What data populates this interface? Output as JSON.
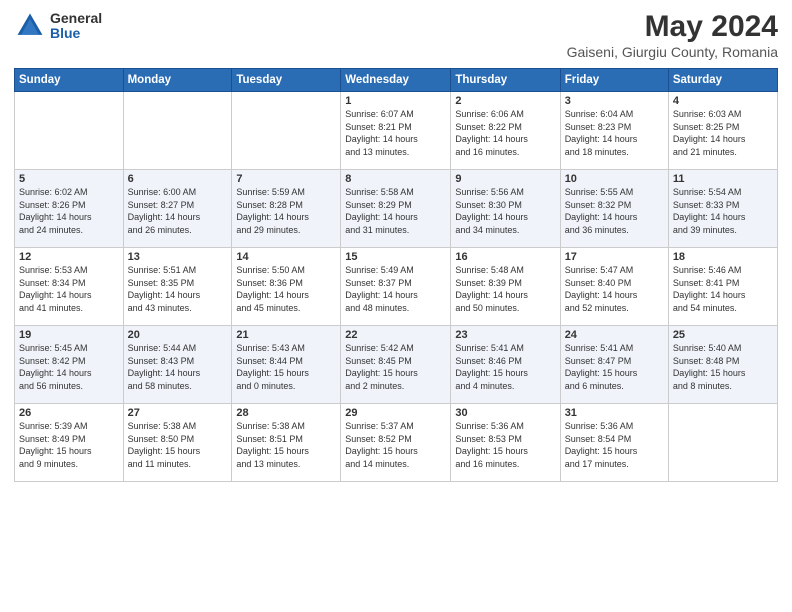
{
  "logo": {
    "general": "General",
    "blue": "Blue"
  },
  "header": {
    "title": "May 2024",
    "subtitle": "Gaiseni, Giurgiu County, Romania"
  },
  "weekdays": [
    "Sunday",
    "Monday",
    "Tuesday",
    "Wednesday",
    "Thursday",
    "Friday",
    "Saturday"
  ],
  "weeks": [
    [
      {
        "day": "",
        "info": ""
      },
      {
        "day": "",
        "info": ""
      },
      {
        "day": "",
        "info": ""
      },
      {
        "day": "1",
        "info": "Sunrise: 6:07 AM\nSunset: 8:21 PM\nDaylight: 14 hours\nand 13 minutes."
      },
      {
        "day": "2",
        "info": "Sunrise: 6:06 AM\nSunset: 8:22 PM\nDaylight: 14 hours\nand 16 minutes."
      },
      {
        "day": "3",
        "info": "Sunrise: 6:04 AM\nSunset: 8:23 PM\nDaylight: 14 hours\nand 18 minutes."
      },
      {
        "day": "4",
        "info": "Sunrise: 6:03 AM\nSunset: 8:25 PM\nDaylight: 14 hours\nand 21 minutes."
      }
    ],
    [
      {
        "day": "5",
        "info": "Sunrise: 6:02 AM\nSunset: 8:26 PM\nDaylight: 14 hours\nand 24 minutes."
      },
      {
        "day": "6",
        "info": "Sunrise: 6:00 AM\nSunset: 8:27 PM\nDaylight: 14 hours\nand 26 minutes."
      },
      {
        "day": "7",
        "info": "Sunrise: 5:59 AM\nSunset: 8:28 PM\nDaylight: 14 hours\nand 29 minutes."
      },
      {
        "day": "8",
        "info": "Sunrise: 5:58 AM\nSunset: 8:29 PM\nDaylight: 14 hours\nand 31 minutes."
      },
      {
        "day": "9",
        "info": "Sunrise: 5:56 AM\nSunset: 8:30 PM\nDaylight: 14 hours\nand 34 minutes."
      },
      {
        "day": "10",
        "info": "Sunrise: 5:55 AM\nSunset: 8:32 PM\nDaylight: 14 hours\nand 36 minutes."
      },
      {
        "day": "11",
        "info": "Sunrise: 5:54 AM\nSunset: 8:33 PM\nDaylight: 14 hours\nand 39 minutes."
      }
    ],
    [
      {
        "day": "12",
        "info": "Sunrise: 5:53 AM\nSunset: 8:34 PM\nDaylight: 14 hours\nand 41 minutes."
      },
      {
        "day": "13",
        "info": "Sunrise: 5:51 AM\nSunset: 8:35 PM\nDaylight: 14 hours\nand 43 minutes."
      },
      {
        "day": "14",
        "info": "Sunrise: 5:50 AM\nSunset: 8:36 PM\nDaylight: 14 hours\nand 45 minutes."
      },
      {
        "day": "15",
        "info": "Sunrise: 5:49 AM\nSunset: 8:37 PM\nDaylight: 14 hours\nand 48 minutes."
      },
      {
        "day": "16",
        "info": "Sunrise: 5:48 AM\nSunset: 8:39 PM\nDaylight: 14 hours\nand 50 minutes."
      },
      {
        "day": "17",
        "info": "Sunrise: 5:47 AM\nSunset: 8:40 PM\nDaylight: 14 hours\nand 52 minutes."
      },
      {
        "day": "18",
        "info": "Sunrise: 5:46 AM\nSunset: 8:41 PM\nDaylight: 14 hours\nand 54 minutes."
      }
    ],
    [
      {
        "day": "19",
        "info": "Sunrise: 5:45 AM\nSunset: 8:42 PM\nDaylight: 14 hours\nand 56 minutes."
      },
      {
        "day": "20",
        "info": "Sunrise: 5:44 AM\nSunset: 8:43 PM\nDaylight: 14 hours\nand 58 minutes."
      },
      {
        "day": "21",
        "info": "Sunrise: 5:43 AM\nSunset: 8:44 PM\nDaylight: 15 hours\nand 0 minutes."
      },
      {
        "day": "22",
        "info": "Sunrise: 5:42 AM\nSunset: 8:45 PM\nDaylight: 15 hours\nand 2 minutes."
      },
      {
        "day": "23",
        "info": "Sunrise: 5:41 AM\nSunset: 8:46 PM\nDaylight: 15 hours\nand 4 minutes."
      },
      {
        "day": "24",
        "info": "Sunrise: 5:41 AM\nSunset: 8:47 PM\nDaylight: 15 hours\nand 6 minutes."
      },
      {
        "day": "25",
        "info": "Sunrise: 5:40 AM\nSunset: 8:48 PM\nDaylight: 15 hours\nand 8 minutes."
      }
    ],
    [
      {
        "day": "26",
        "info": "Sunrise: 5:39 AM\nSunset: 8:49 PM\nDaylight: 15 hours\nand 9 minutes."
      },
      {
        "day": "27",
        "info": "Sunrise: 5:38 AM\nSunset: 8:50 PM\nDaylight: 15 hours\nand 11 minutes."
      },
      {
        "day": "28",
        "info": "Sunrise: 5:38 AM\nSunset: 8:51 PM\nDaylight: 15 hours\nand 13 minutes."
      },
      {
        "day": "29",
        "info": "Sunrise: 5:37 AM\nSunset: 8:52 PM\nDaylight: 15 hours\nand 14 minutes."
      },
      {
        "day": "30",
        "info": "Sunrise: 5:36 AM\nSunset: 8:53 PM\nDaylight: 15 hours\nand 16 minutes."
      },
      {
        "day": "31",
        "info": "Sunrise: 5:36 AM\nSunset: 8:54 PM\nDaylight: 15 hours\nand 17 minutes."
      },
      {
        "day": "",
        "info": ""
      }
    ]
  ]
}
